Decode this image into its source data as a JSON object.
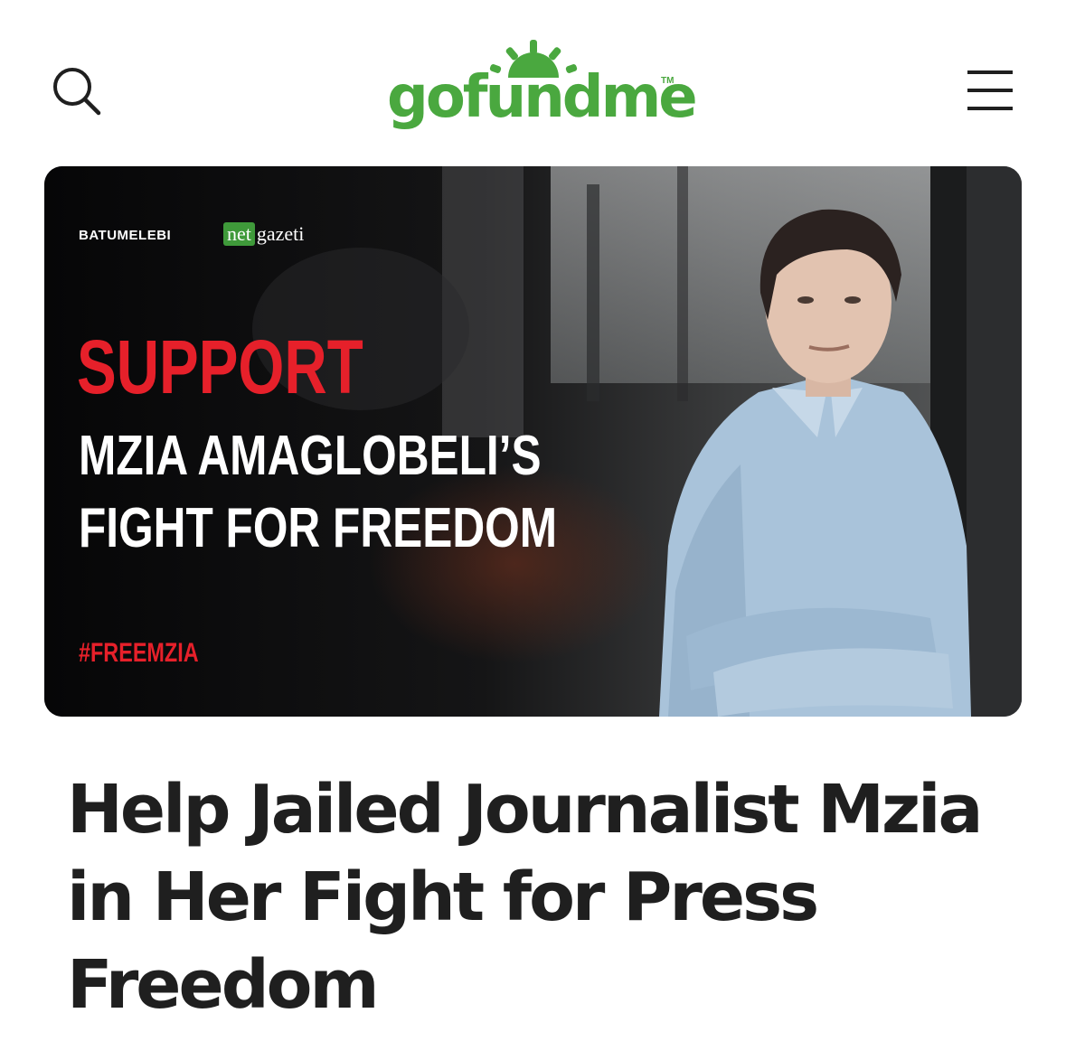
{
  "header": {
    "logo_text": "gofundme",
    "logo_tm": "TM",
    "search_icon": "search-icon",
    "menu_icon": "hamburger-menu-icon"
  },
  "colors": {
    "brand_green": "#3f9a3a",
    "logo_green": "#4aa83f",
    "title_text": "#1f1f1f",
    "hero_red": "#e6202a",
    "hero_background": "#0a0a0b"
  },
  "hero": {
    "brand_batumelebi": "BATUMELEBI",
    "brand_netgazeti_box": "net",
    "brand_netgazeti_text": "gazeti",
    "line1": "SUPPORT",
    "line2": "MZIA AMAGLOBELI’S",
    "line3": "FIGHT FOR FREEDOM",
    "hashtag": "#FREEMZIA"
  },
  "campaign": {
    "title": "Help Jailed Journalist Mzia in Her Fight for Press Freedom"
  }
}
